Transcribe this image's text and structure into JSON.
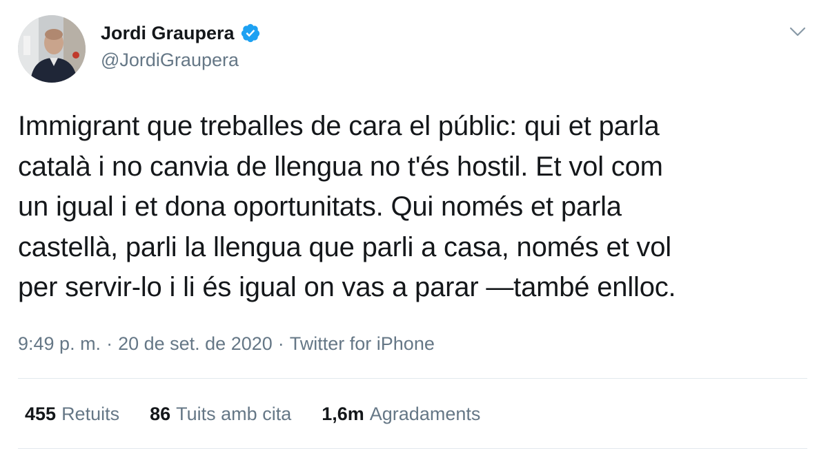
{
  "author": {
    "display_name": "Jordi Graupera",
    "handle": "@JordiGraupera",
    "verified": true,
    "verified_color": "#1da1f2"
  },
  "tweet": {
    "text": "Immigrant que treballes de cara el públic: qui et parla\ncatalà i no canvia de llengua no t'és hostil. Et vol com\nun igual i et dona oportunitats. Qui només et parla\ncastellà, parli la llengua que parli a casa, només et vol\nper servir-lo i li és igual on vas a parar —també enlloc."
  },
  "meta": {
    "time": "9:49 p. m.",
    "separator": "·",
    "date": "20 de set. de 2020",
    "source": "Twitter for iPhone"
  },
  "stats": [
    {
      "count": "455",
      "label": "Retuits"
    },
    {
      "count": "86",
      "label": "Tuits amb cita"
    },
    {
      "count": "1,6m",
      "label": "Agradaments"
    }
  ],
  "icons": {
    "caret": "chevron-down-icon",
    "verified": "verified-badge-icon"
  },
  "colors": {
    "text_primary": "#14171a",
    "text_secondary": "#657786",
    "divider": "#e1e8ed"
  }
}
